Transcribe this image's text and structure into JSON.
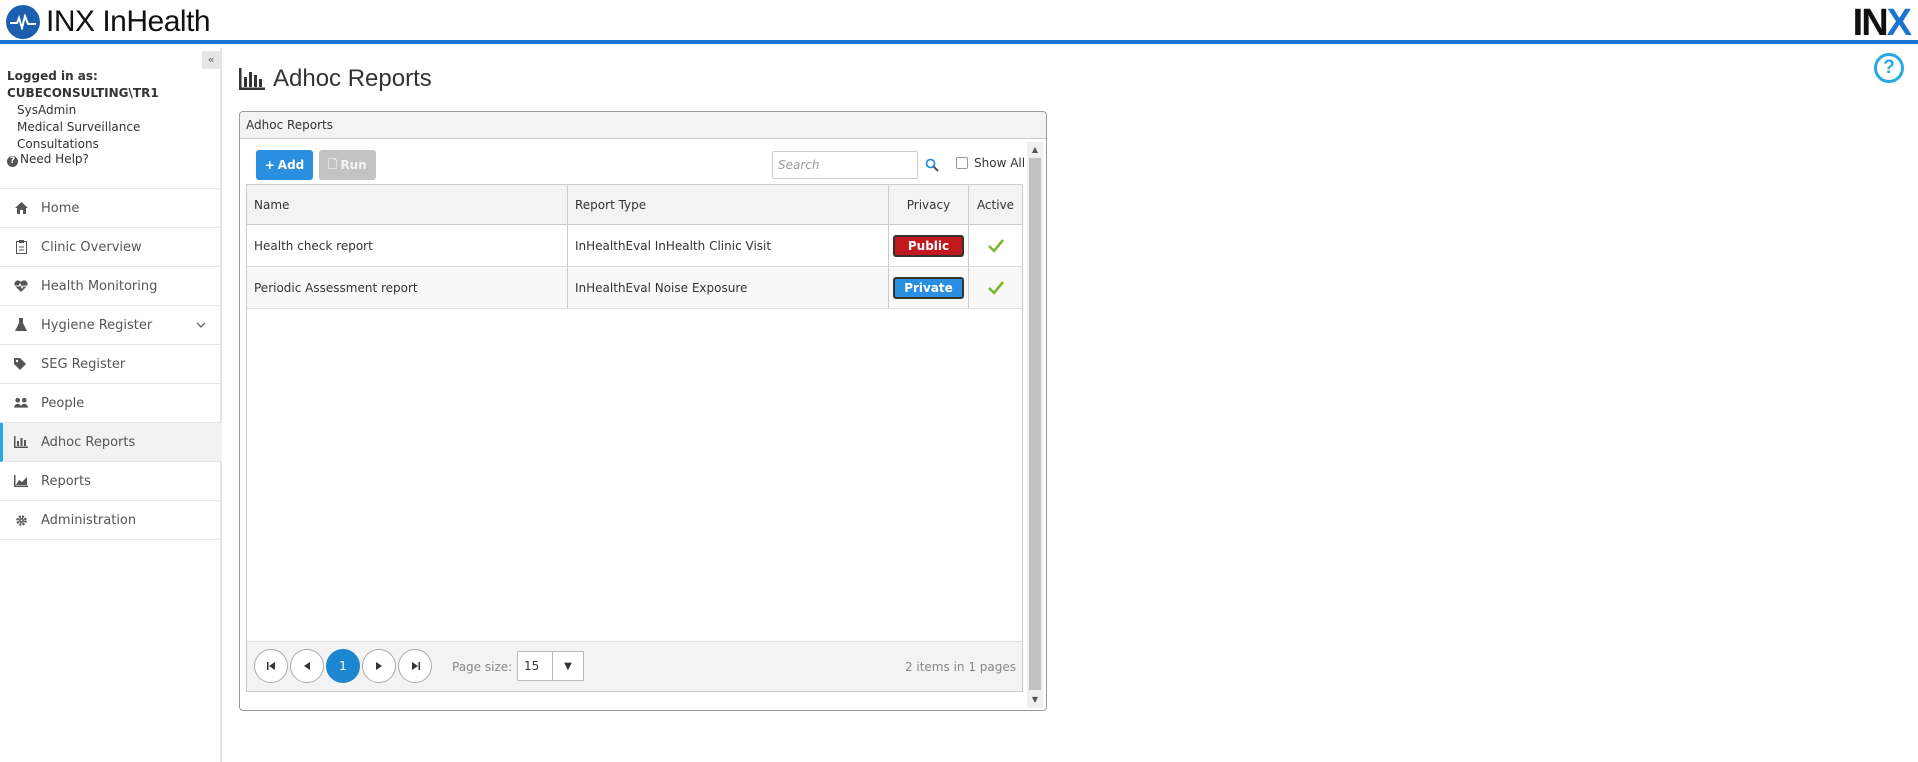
{
  "header": {
    "app_title": "INX InHealth",
    "brand_left": "IN",
    "brand_x": "X"
  },
  "help_icon_glyph": "?",
  "sidebar": {
    "collapse_glyph": "«",
    "logged_in_label": "Logged in as:",
    "username": "CUBECONSULTING\\TR1",
    "role": "SysAdmin",
    "organization": "Medical Surveillance Consultations",
    "need_help": "Need Help?",
    "items": [
      {
        "label": "Home",
        "icon": "home-icon"
      },
      {
        "label": "Clinic Overview",
        "icon": "clipboard-icon"
      },
      {
        "label": "Health Monitoring",
        "icon": "heartbeat-icon"
      },
      {
        "label": "Hygiene Register",
        "icon": "flask-icon"
      },
      {
        "label": "SEG Register",
        "icon": "tags-icon"
      },
      {
        "label": "People",
        "icon": "users-icon"
      },
      {
        "label": "Adhoc Reports",
        "icon": "bar-chart-icon"
      },
      {
        "label": "Reports",
        "icon": "area-chart-icon"
      },
      {
        "label": "Administration",
        "icon": "gear-icon"
      }
    ],
    "active_item": "Adhoc Reports"
  },
  "main": {
    "page_title": "Adhoc Reports",
    "panel_title": "Adhoc Reports",
    "toolbar": {
      "add_label": "Add",
      "run_label": "Run",
      "search_placeholder": "Search",
      "show_all_label": "Show All"
    },
    "grid": {
      "columns": [
        "Name",
        "Report Type",
        "Privacy",
        "Active"
      ],
      "rows": [
        {
          "name": "Health check report",
          "report_type": "InHealthEval InHealth Clinic Visit",
          "privacy": "Public",
          "active": true
        },
        {
          "name": "Periodic Assessment report",
          "report_type": "InHealthEval Noise Exposure",
          "privacy": "Private",
          "active": true
        }
      ]
    },
    "pager": {
      "current_page": "1",
      "page_size_label": "Page size:",
      "page_size": "15",
      "info": "2 items in 1 pages"
    }
  },
  "colors": {
    "accent": "#1b75d0",
    "public_badge": "#c0181d",
    "private_badge": "#2a8fe0",
    "check": "#7cb82f"
  }
}
